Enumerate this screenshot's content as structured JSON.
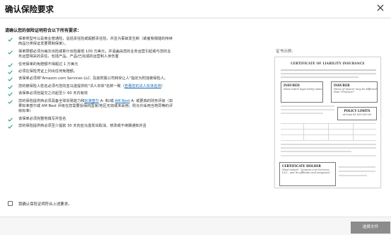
{
  "dialog": {
    "title": "确认保险要求",
    "intro": "请确认您的保险证明符合以下所有要求："
  },
  "requirements": [
    [
      "保单类型可以是商业普通险，总括责任险或超额责任险，并且为事故发生制（或者我我隧的持续商品分类保证发要限制保单）。"
    ],
    [
      "保单限额必须为每次出险或累计出险最低 100 万美元，并涵盖由您的业务运营引起或与您的业务运营相关的责任，包括产品，产品/已完成的运营和人身伤害"
    ],
    [
      "任何保单的免赔额不得超过 1 万美元"
    ],
    [
      "必须在保险凭证上列出任何免赔额。"
    ],
    [
      "该保单必须将\"Amazon.com Services LLC. 及其附属公司和受让人\"指定为附加被保险人。"
    ],
    [
      "您的被保险人姓名必须与您向亚马逊提供的\"法人实体\"名称一致（",
      {
        "link": "查看您的法人实体名称"
      },
      "）"
    ],
    [
      "该保单必须自提交之日起至少 60 天内有效"
    ],
    [
      "您的保险提供商必须具备全球贸易能力和",
      {
        "link": "标准普尔"
      },
      " A- 和/或 ",
      {
        "link": "AM Best"
      },
      " A- 或更高的财务评级（如果标准普尔或 AM Best 评级在您需要投保的国家/地区无效或未采用，则允许采用当地同等的评级标准）"
    ],
    [
      "该保单必须完整地填写并签名"
    ],
    [
      "您的保险提供商必须至少提前 30 天向亚马逊发出取消、修改或不续期通知并且"
    ]
  ],
  "confirm": {
    "label": "我确认保险证明符合上述要求。",
    "checked": false
  },
  "example": {
    "label": "证书示例:",
    "certificate_title": "CERTIFICATE OF LIABILITY INSURANCE",
    "insured_heading": "INSURED",
    "insured_note": "Must match legal entity name",
    "insurer_heading": "INSURER",
    "insurer_note": "Name of insurer may be different than \"Producer\"",
    "limits_heading": "POLICY LIMITS",
    "limits_note": "at least $1,000,000.00",
    "holder_heading": "CERTIFICATE HOLDER",
    "holder_note": "Must named: \"Amazon.com Services LLC., and its affiliates and assignees\""
  },
  "footer": {
    "select_button": "选择文件"
  },
  "colors": {
    "check": "#2a9d8f",
    "link": "#1a6fb5",
    "button_disabled": "#8c8c8c"
  },
  "icons": {
    "close": "close-icon",
    "check": "check-icon"
  }
}
